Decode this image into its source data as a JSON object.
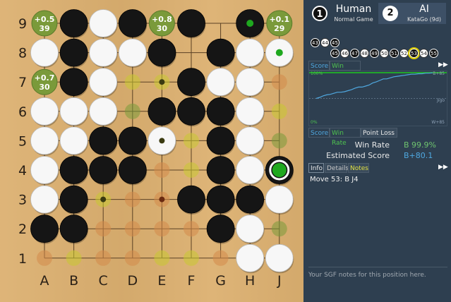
{
  "board": {
    "size": 9,
    "col_labels": [
      "A",
      "B",
      "C",
      "D",
      "E",
      "F",
      "G",
      "H",
      "J"
    ],
    "row_labels": [
      "9",
      "8",
      "7",
      "6",
      "5",
      "4",
      "3",
      "2",
      "1"
    ],
    "colors": {
      "board": "#dcb070",
      "line": "#5a4024",
      "black": "#151515",
      "white": "#f7f7f7",
      "hint_green": "#7a9a3a",
      "hint_orange": "#d48a4a",
      "hint_yellow": "#c8c832"
    },
    "stones": [
      {
        "c": "B",
        "x": 1,
        "y": 0
      },
      {
        "c": "W",
        "x": 2,
        "y": 0
      },
      {
        "c": "B",
        "x": 3,
        "y": 0
      },
      {
        "c": "B",
        "x": 5,
        "y": 0
      },
      {
        "c": "B",
        "x": 7,
        "y": 0
      },
      {
        "c": "W",
        "x": 0,
        "y": 1
      },
      {
        "c": "B",
        "x": 1,
        "y": 1
      },
      {
        "c": "W",
        "x": 2,
        "y": 1
      },
      {
        "c": "W",
        "x": 3,
        "y": 1
      },
      {
        "c": "B",
        "x": 4,
        "y": 1
      },
      {
        "c": "B",
        "x": 6,
        "y": 1
      },
      {
        "c": "W",
        "x": 7,
        "y": 1
      },
      {
        "c": "W",
        "x": 8,
        "y": 1
      },
      {
        "c": "B",
        "x": 1,
        "y": 2
      },
      {
        "c": "W",
        "x": 2,
        "y": 2
      },
      {
        "c": "B",
        "x": 5,
        "y": 2
      },
      {
        "c": "W",
        "x": 6,
        "y": 2
      },
      {
        "c": "W",
        "x": 7,
        "y": 2
      },
      {
        "c": "W",
        "x": 0,
        "y": 3
      },
      {
        "c": "W",
        "x": 1,
        "y": 3
      },
      {
        "c": "W",
        "x": 2,
        "y": 3
      },
      {
        "c": "B",
        "x": 4,
        "y": 3
      },
      {
        "c": "B",
        "x": 5,
        "y": 3
      },
      {
        "c": "B",
        "x": 6,
        "y": 3
      },
      {
        "c": "W",
        "x": 7,
        "y": 3
      },
      {
        "c": "W",
        "x": 0,
        "y": 4
      },
      {
        "c": "W",
        "x": 1,
        "y": 4
      },
      {
        "c": "B",
        "x": 2,
        "y": 4
      },
      {
        "c": "B",
        "x": 3,
        "y": 4
      },
      {
        "c": "W",
        "x": 4,
        "y": 4
      },
      {
        "c": "B",
        "x": 6,
        "y": 4
      },
      {
        "c": "W",
        "x": 7,
        "y": 4
      },
      {
        "c": "W",
        "x": 0,
        "y": 5
      },
      {
        "c": "B",
        "x": 1,
        "y": 5
      },
      {
        "c": "B",
        "x": 2,
        "y": 5
      },
      {
        "c": "B",
        "x": 3,
        "y": 5
      },
      {
        "c": "B",
        "x": 6,
        "y": 5
      },
      {
        "c": "W",
        "x": 7,
        "y": 5
      },
      {
        "c": "B",
        "x": 8,
        "y": 5
      },
      {
        "c": "W",
        "x": 0,
        "y": 6
      },
      {
        "c": "B",
        "x": 1,
        "y": 6
      },
      {
        "c": "B",
        "x": 5,
        "y": 6
      },
      {
        "c": "B",
        "x": 6,
        "y": 6
      },
      {
        "c": "B",
        "x": 7,
        "y": 6
      },
      {
        "c": "W",
        "x": 8,
        "y": 6
      },
      {
        "c": "B",
        "x": 0,
        "y": 7
      },
      {
        "c": "B",
        "x": 1,
        "y": 7
      },
      {
        "c": "B",
        "x": 6,
        "y": 7
      },
      {
        "c": "W",
        "x": 7,
        "y": 7
      },
      {
        "c": "W",
        "x": 7,
        "y": 8
      },
      {
        "c": "W",
        "x": 8,
        "y": 8
      }
    ],
    "candidates": [
      {
        "x": 0,
        "y": 0,
        "score": "+0.5",
        "visits": "39"
      },
      {
        "x": 4,
        "y": 0,
        "score": "+0.8",
        "visits": "30"
      },
      {
        "x": 8,
        "y": 0,
        "score": "+0.1",
        "visits": "29"
      },
      {
        "x": 0,
        "y": 2,
        "score": "+0.7",
        "visits": "30"
      }
    ],
    "hints": [
      {
        "x": 3,
        "y": 2,
        "t": "y"
      },
      {
        "x": 4,
        "y": 2,
        "t": "y"
      },
      {
        "x": 8,
        "y": 2,
        "t": "o"
      },
      {
        "x": 3,
        "y": 3,
        "t": "g"
      },
      {
        "x": 8,
        "y": 3,
        "t": "y"
      },
      {
        "x": 4,
        "y": 4,
        "t": "y"
      },
      {
        "x": 5,
        "y": 4,
        "t": "y"
      },
      {
        "x": 8,
        "y": 4,
        "t": "g"
      },
      {
        "x": 4,
        "y": 5,
        "t": "o"
      },
      {
        "x": 5,
        "y": 5,
        "t": "y"
      },
      {
        "x": 2,
        "y": 6,
        "t": "y"
      },
      {
        "x": 3,
        "y": 6,
        "t": "o"
      },
      {
        "x": 4,
        "y": 6,
        "t": "o"
      },
      {
        "x": 2,
        "y": 7,
        "t": "o"
      },
      {
        "x": 3,
        "y": 7,
        "t": "o"
      },
      {
        "x": 4,
        "y": 7,
        "t": "o"
      },
      {
        "x": 5,
        "y": 7,
        "t": "o"
      },
      {
        "x": 8,
        "y": 7,
        "t": "g"
      },
      {
        "x": 0,
        "y": 8,
        "t": "o"
      },
      {
        "x": 1,
        "y": 8,
        "t": "y"
      },
      {
        "x": 2,
        "y": 8,
        "t": "o"
      },
      {
        "x": 3,
        "y": 8,
        "t": "o"
      },
      {
        "x": 4,
        "y": 8,
        "t": "y"
      },
      {
        "x": 5,
        "y": 8,
        "t": "y"
      },
      {
        "x": 6,
        "y": 8,
        "t": "o"
      }
    ],
    "dots": [
      {
        "x": 4,
        "y": 2,
        "c": "#3a3a10"
      },
      {
        "x": 4,
        "y": 4,
        "c": "#3a3a10"
      },
      {
        "x": 2,
        "y": 6,
        "c": "#3a3a10"
      },
      {
        "x": 4,
        "y": 6,
        "c": "#6a2a10"
      }
    ],
    "last_move": {
      "x": 8,
      "y": 5
    },
    "green_marks": [
      {
        "x": 7,
        "y": 0
      },
      {
        "x": 8,
        "y": 1
      }
    ]
  },
  "players": {
    "black": {
      "num": "1",
      "name": "Human",
      "sub": "Normal Game"
    },
    "white": {
      "num": "2",
      "name": "AI",
      "sub": "KataGo (9d)"
    }
  },
  "move_tree": {
    "top": [
      "43",
      "44",
      "45"
    ],
    "bottom": [
      "45",
      "46",
      "47",
      "48",
      "49",
      "50",
      "51",
      "52",
      "53",
      "54",
      "55"
    ]
  },
  "graph_tabs": {
    "score": "Score",
    "winrate": "Win Rate"
  },
  "graph": {
    "label_top": "100%",
    "label_bottom": "0%",
    "label_mid": "Jigo",
    "label_right_top": "B+85",
    "label_right_bottom": "W+85",
    "winrate_series": [
      50,
      52,
      55,
      57,
      58,
      60,
      62,
      62,
      63,
      65,
      67,
      70,
      72,
      72,
      74,
      76,
      80,
      82,
      85,
      88,
      88,
      90,
      92,
      93,
      94,
      95,
      96,
      97,
      97,
      98,
      98,
      99,
      99,
      99.9
    ]
  },
  "info_tabs": {
    "score": "Score",
    "winrate": "Win Rate",
    "pointloss": "Point Loss"
  },
  "stats": {
    "wr_label": "Win Rate",
    "wr_value": "B 99.9%",
    "es_label": "Estimated Score",
    "es_value": "B+80.1"
  },
  "notes_tabs": {
    "info": "Info",
    "details": "Details",
    "notes": "Notes"
  },
  "move_info": "Move 53: B J4",
  "sgf_placeholder": "Your SGF notes for this position here."
}
